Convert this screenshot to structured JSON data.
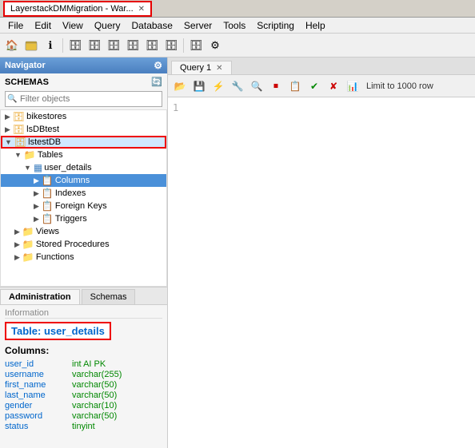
{
  "titlebar": {
    "tab_label": "LayerstackDMMigration - War...",
    "close_label": "✕"
  },
  "menubar": {
    "items": [
      "File",
      "Edit",
      "View",
      "Query",
      "Database",
      "Server",
      "Tools",
      "Scripting",
      "Help"
    ]
  },
  "navigator": {
    "title": "Navigator",
    "schemas_label": "SCHEMAS",
    "filter_placeholder": "Filter objects"
  },
  "tree": {
    "items": [
      {
        "id": "bikestores",
        "label": "bikestores",
        "level": 1,
        "type": "db",
        "expanded": false
      },
      {
        "id": "lsDBtest",
        "label": "lsDBtest",
        "level": 1,
        "type": "db",
        "expanded": false
      },
      {
        "id": "lstestDB",
        "label": "lstestDB",
        "level": 1,
        "type": "db",
        "expanded": true,
        "selected": true
      },
      {
        "id": "tables",
        "label": "Tables",
        "level": 2,
        "type": "folder",
        "expanded": true
      },
      {
        "id": "user_details",
        "label": "user_details",
        "level": 3,
        "type": "table",
        "expanded": true
      },
      {
        "id": "columns",
        "label": "Columns",
        "level": 4,
        "type": "folder",
        "expanded": false,
        "highlighted": true
      },
      {
        "id": "indexes",
        "label": "Indexes",
        "level": 5,
        "type": "folder",
        "expanded": false
      },
      {
        "id": "foreign_keys",
        "label": "Foreign Keys",
        "level": 5,
        "type": "folder",
        "expanded": false
      },
      {
        "id": "triggers",
        "label": "Triggers",
        "level": 5,
        "type": "folder",
        "expanded": false
      },
      {
        "id": "views",
        "label": "Views",
        "level": 2,
        "type": "folder",
        "expanded": false
      },
      {
        "id": "stored_procedures",
        "label": "Stored Procedures",
        "level": 2,
        "type": "folder",
        "expanded": false
      },
      {
        "id": "functions",
        "label": "Functions",
        "level": 2,
        "type": "folder",
        "expanded": false
      }
    ]
  },
  "bottom_tabs": [
    {
      "label": "Administration",
      "active": true
    },
    {
      "label": "Schemas",
      "active": false
    }
  ],
  "info_panel": {
    "info_label": "Information",
    "table_prefix": "Table: ",
    "table_name": "user_details",
    "columns_title": "Columns:",
    "columns": [
      {
        "name": "user_id",
        "type": "int AI PK"
      },
      {
        "name": "username",
        "type": "varchar(255)"
      },
      {
        "name": "first_name",
        "type": "varchar(50)"
      },
      {
        "name": "last_name",
        "type": "varchar(50)"
      },
      {
        "name": "gender",
        "type": "varchar(10)"
      },
      {
        "name": "password",
        "type": "varchar(50)"
      },
      {
        "name": "status",
        "type": "tinyint"
      }
    ]
  },
  "query_tab": {
    "label": "Query 1",
    "close_label": "✕"
  },
  "query_toolbar": {
    "buttons": [
      "📂",
      "💾",
      "⚡",
      "🔧",
      "🔍",
      "🛑",
      "📋",
      "✅",
      "❌",
      "📊"
    ],
    "limit_text": "Limit to 1000 row"
  },
  "query_editor": {
    "line_number": "1"
  }
}
